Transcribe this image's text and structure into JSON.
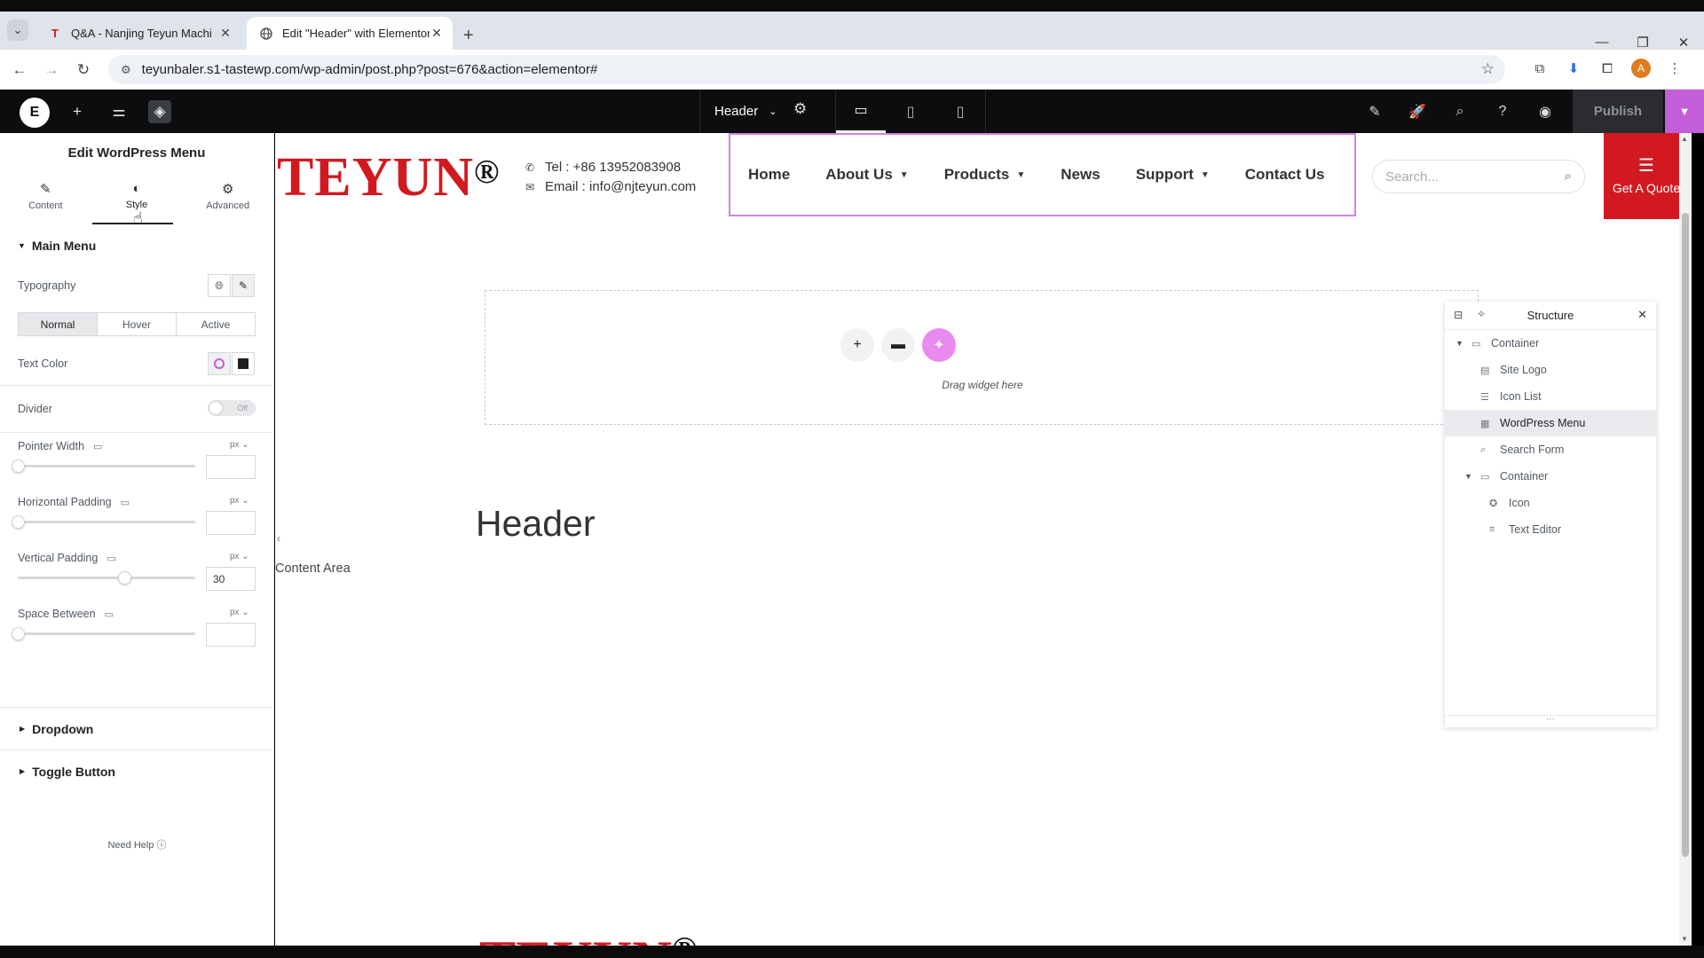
{
  "browser": {
    "tabs": [
      {
        "label": "Q&A - Nanjing Teyun Machi",
        "favicon": "T",
        "active": false
      },
      {
        "label": "Edit \"Header\" with Elementor",
        "favicon": "globe-icon",
        "active": true
      }
    ],
    "url": "teyunbaler.s1-tastewp.com/wp-admin/post.php?post=676&action=elementor#",
    "profile_initial": "A"
  },
  "editor_bar": {
    "document_name": "Header",
    "publish_label": "Publish",
    "publish_accent": "#c35ed8"
  },
  "panel": {
    "title": "Edit WordPress Menu",
    "tabs": [
      "Content",
      "Style",
      "Advanced"
    ],
    "active_tab": "Style",
    "section_main": "Main Menu",
    "typography_label": "Typography",
    "states": [
      "Normal",
      "Hover",
      "Active"
    ],
    "active_state": "Normal",
    "text_color_label": "Text Color",
    "divider_label": "Divider",
    "divider_toggle": "Off",
    "pointer_width": {
      "label": "Pointer Width",
      "unit": "px",
      "value": ""
    },
    "horizontal_padding": {
      "label": "Horizontal Padding",
      "unit": "px",
      "value": ""
    },
    "vertical_padding": {
      "label": "Vertical Padding",
      "unit": "px",
      "value": "30"
    },
    "space_between": {
      "label": "Space Between",
      "unit": "px",
      "value": ""
    },
    "section_dropdown": "Dropdown",
    "section_toggle": "Toggle Button",
    "need_help": "Need Help"
  },
  "site": {
    "logo_text": "TEYUN",
    "logo_mark": "®",
    "brand_color": "#d21920",
    "tel": "Tel : +86 13952083908",
    "email": "Email : info@njteyun.com",
    "menu": [
      {
        "label": "Home",
        "has_dropdown": false
      },
      {
        "label": "About Us",
        "has_dropdown": true
      },
      {
        "label": "Products",
        "has_dropdown": true
      },
      {
        "label": "News",
        "has_dropdown": false
      },
      {
        "label": "Support",
        "has_dropdown": true
      },
      {
        "label": "Contact Us",
        "has_dropdown": false
      }
    ],
    "search_placeholder": "Search...",
    "quote_label": "Get A Quote"
  },
  "canvas": {
    "drag_text": "Drag widget here",
    "heading": "Header",
    "content_area": "Content Area"
  },
  "structure": {
    "title": "Structure",
    "items": [
      {
        "label": "Container",
        "level": 0,
        "expandable": true,
        "icon": "container-icon",
        "selected": false
      },
      {
        "label": "Site Logo",
        "level": 1,
        "expandable": false,
        "icon": "site-logo-icon",
        "selected": false
      },
      {
        "label": "Icon List",
        "level": 1,
        "expandable": false,
        "icon": "icon-list-icon",
        "selected": false
      },
      {
        "label": "WordPress Menu",
        "level": 1,
        "expandable": false,
        "icon": "wordpress-menu-icon",
        "selected": true
      },
      {
        "label": "Search Form",
        "level": 1,
        "expandable": false,
        "icon": "search-form-icon",
        "selected": false
      },
      {
        "label": "Container",
        "level": 1,
        "expandable": true,
        "icon": "container-icon",
        "selected": false
      },
      {
        "label": "Icon",
        "level": 2,
        "expandable": false,
        "icon": "icon-widget-icon",
        "selected": false
      },
      {
        "label": "Text Editor",
        "level": 2,
        "expandable": false,
        "icon": "text-editor-icon",
        "selected": false
      }
    ]
  }
}
